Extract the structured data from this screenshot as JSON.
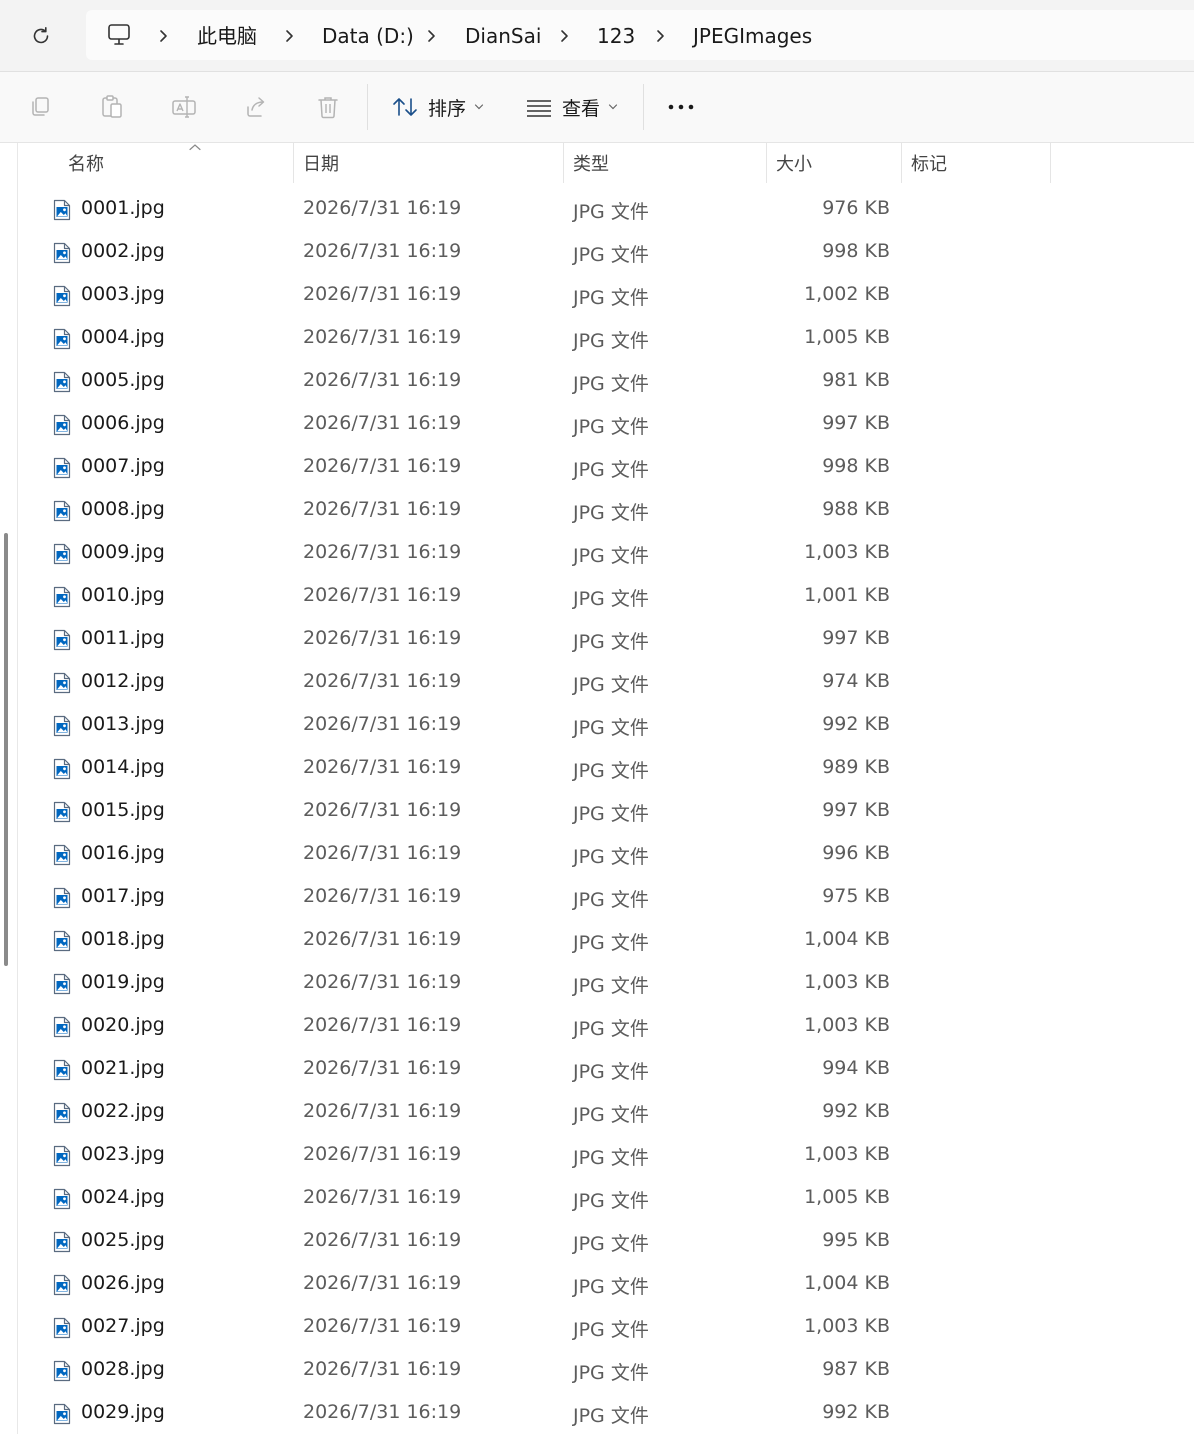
{
  "address_bar": {
    "breadcrumbs": [
      "此电脑",
      "Data (D:)",
      "DianSai",
      "123",
      "JPEGImages"
    ]
  },
  "command_bar": {
    "sort_label": "排序",
    "view_label": "查看"
  },
  "columns": {
    "name": "名称",
    "date": "日期",
    "type": "类型",
    "size": "大小",
    "tags": "标记"
  },
  "colors": {
    "accent": "#0067c0",
    "disabled_icon": "#b4b4b4",
    "scrollbar": "#8a8a8a"
  },
  "files": [
    {
      "name": "0001.jpg",
      "date": "2026/7/31 16:19",
      "type": "JPG 文件",
      "size": "976 KB"
    },
    {
      "name": "0002.jpg",
      "date": "2026/7/31 16:19",
      "type": "JPG 文件",
      "size": "998 KB"
    },
    {
      "name": "0003.jpg",
      "date": "2026/7/31 16:19",
      "type": "JPG 文件",
      "size": "1,002 KB"
    },
    {
      "name": "0004.jpg",
      "date": "2026/7/31 16:19",
      "type": "JPG 文件",
      "size": "1,005 KB"
    },
    {
      "name": "0005.jpg",
      "date": "2026/7/31 16:19",
      "type": "JPG 文件",
      "size": "981 KB"
    },
    {
      "name": "0006.jpg",
      "date": "2026/7/31 16:19",
      "type": "JPG 文件",
      "size": "997 KB"
    },
    {
      "name": "0007.jpg",
      "date": "2026/7/31 16:19",
      "type": "JPG 文件",
      "size": "998 KB"
    },
    {
      "name": "0008.jpg",
      "date": "2026/7/31 16:19",
      "type": "JPG 文件",
      "size": "988 KB"
    },
    {
      "name": "0009.jpg",
      "date": "2026/7/31 16:19",
      "type": "JPG 文件",
      "size": "1,003 KB"
    },
    {
      "name": "0010.jpg",
      "date": "2026/7/31 16:19",
      "type": "JPG 文件",
      "size": "1,001 KB"
    },
    {
      "name": "0011.jpg",
      "date": "2026/7/31 16:19",
      "type": "JPG 文件",
      "size": "997 KB"
    },
    {
      "name": "0012.jpg",
      "date": "2026/7/31 16:19",
      "type": "JPG 文件",
      "size": "974 KB"
    },
    {
      "name": "0013.jpg",
      "date": "2026/7/31 16:19",
      "type": "JPG 文件",
      "size": "992 KB"
    },
    {
      "name": "0014.jpg",
      "date": "2026/7/31 16:19",
      "type": "JPG 文件",
      "size": "989 KB"
    },
    {
      "name": "0015.jpg",
      "date": "2026/7/31 16:19",
      "type": "JPG 文件",
      "size": "997 KB"
    },
    {
      "name": "0016.jpg",
      "date": "2026/7/31 16:19",
      "type": "JPG 文件",
      "size": "996 KB"
    },
    {
      "name": "0017.jpg",
      "date": "2026/7/31 16:19",
      "type": "JPG 文件",
      "size": "975 KB"
    },
    {
      "name": "0018.jpg",
      "date": "2026/7/31 16:19",
      "type": "JPG 文件",
      "size": "1,004 KB"
    },
    {
      "name": "0019.jpg",
      "date": "2026/7/31 16:19",
      "type": "JPG 文件",
      "size": "1,003 KB"
    },
    {
      "name": "0020.jpg",
      "date": "2026/7/31 16:19",
      "type": "JPG 文件",
      "size": "1,003 KB"
    },
    {
      "name": "0021.jpg",
      "date": "2026/7/31 16:19",
      "type": "JPG 文件",
      "size": "994 KB"
    },
    {
      "name": "0022.jpg",
      "date": "2026/7/31 16:19",
      "type": "JPG 文件",
      "size": "992 KB"
    },
    {
      "name": "0023.jpg",
      "date": "2026/7/31 16:19",
      "type": "JPG 文件",
      "size": "1,003 KB"
    },
    {
      "name": "0024.jpg",
      "date": "2026/7/31 16:19",
      "type": "JPG 文件",
      "size": "1,005 KB"
    },
    {
      "name": "0025.jpg",
      "date": "2026/7/31 16:19",
      "type": "JPG 文件",
      "size": "995 KB"
    },
    {
      "name": "0026.jpg",
      "date": "2026/7/31 16:19",
      "type": "JPG 文件",
      "size": "1,004 KB"
    },
    {
      "name": "0027.jpg",
      "date": "2026/7/31 16:19",
      "type": "JPG 文件",
      "size": "1,003 KB"
    },
    {
      "name": "0028.jpg",
      "date": "2026/7/31 16:19",
      "type": "JPG 文件",
      "size": "987 KB"
    },
    {
      "name": "0029.jpg",
      "date": "2026/7/31 16:19",
      "type": "JPG 文件",
      "size": "992 KB"
    }
  ]
}
